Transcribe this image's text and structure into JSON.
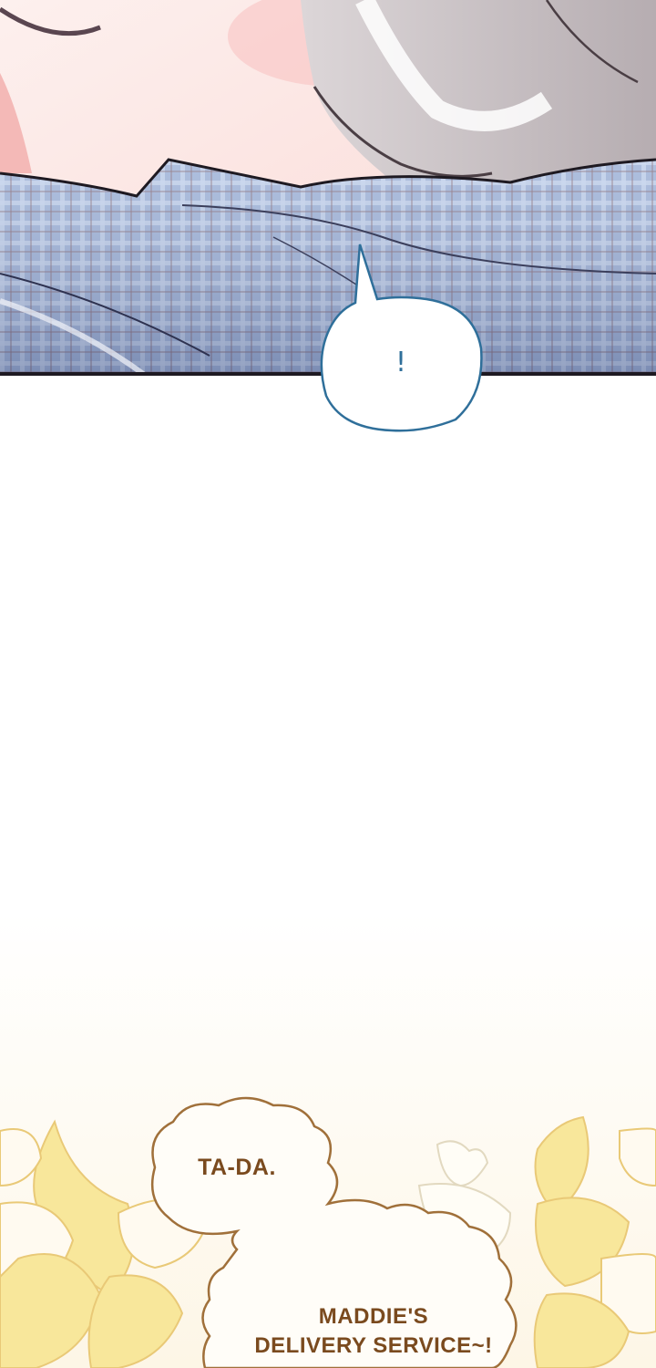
{
  "panels": {
    "top": {
      "bubble_text": "!"
    },
    "bottom": {
      "bubble_line_1": "TA-DA.",
      "bubble_line_2": "MADDIE'S",
      "bubble_line_3": "DELIVERY SERVICE~!"
    }
  },
  "colors": {
    "skin": "#fbe3e0",
    "hair": "#c9c2c4",
    "blanket": "#8fa7d0",
    "bubble_outline_blue": "#2f6f9a",
    "bubble_outline_brown": "#a0703a",
    "text_brown": "#7a4a1e",
    "flower_yellow": "#f8e79b"
  }
}
